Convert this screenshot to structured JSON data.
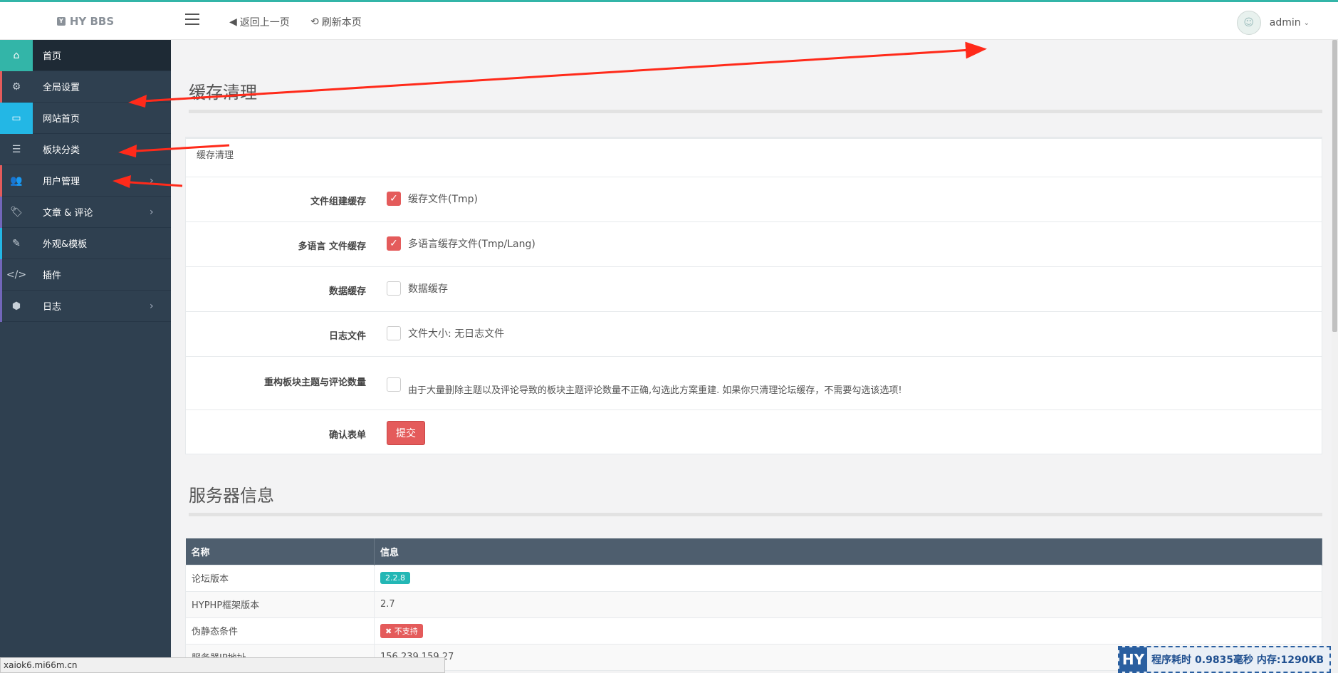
{
  "header": {
    "brand": "HY BBS",
    "back_link": "返回上一页",
    "refresh_link": "刷新本页",
    "username": "admin"
  },
  "sidebar": {
    "items": [
      {
        "label": "首页",
        "icon": "home-icon"
      },
      {
        "label": "全局设置",
        "icon": "gear-icon"
      },
      {
        "label": "网站首页",
        "icon": "monitor-icon"
      },
      {
        "label": "板块分类",
        "icon": "list-icon"
      },
      {
        "label": "用户管理",
        "icon": "users-icon"
      },
      {
        "label": "文章 & 评论",
        "icon": "tags-icon"
      },
      {
        "label": "外观&模板",
        "icon": "brush-icon"
      },
      {
        "label": "插件",
        "icon": "code-icon"
      },
      {
        "label": "日志",
        "icon": "cube-icon"
      }
    ]
  },
  "cache": {
    "title": "缓存清理",
    "panel_heading": "缓存清理",
    "rows": [
      {
        "label": "文件组建缓存",
        "option": "缓存文件(Tmp)",
        "checked": true
      },
      {
        "label": "多语言 文件缓存",
        "option": "多语言缓存文件(Tmp/Lang)",
        "checked": true
      },
      {
        "label": "数据缓存",
        "option": "数据缓存",
        "checked": false
      },
      {
        "label": "日志文件",
        "option": "文件大小: 无日志文件",
        "checked": false
      },
      {
        "label": "重构板块主题与评论数量",
        "option": "由于大量删除主题以及评论导致的板块主题评论数量不正确,勾选此方案重建. 如果你只清理论坛缓存，不需要勾选该选项!",
        "checked": false
      }
    ],
    "confirm_label": "确认表单",
    "submit_label": "提交"
  },
  "server": {
    "title": "服务器信息",
    "columns": [
      "名称",
      "信息"
    ],
    "rows": [
      {
        "name": "论坛版本",
        "value": "2.2.8"
      },
      {
        "name": "HYPHP框架版本",
        "value": "2.7"
      },
      {
        "name": "伪静态条件",
        "value": "✖ 不支持"
      },
      {
        "name": "服务器IP地址",
        "value": "156.239.159.27"
      }
    ]
  },
  "statusbar": {
    "url": "xaiok6.mi66m.cn"
  },
  "debug": {
    "logo": "HY",
    "text": "程序耗时 0.9835毫秒 内存:1290KB"
  },
  "colors": {
    "accent_teal": "#33b5a8",
    "sidebar_bg": "#2f4050",
    "danger": "#e45b5b",
    "arrow_red": "#ff2a1a"
  }
}
